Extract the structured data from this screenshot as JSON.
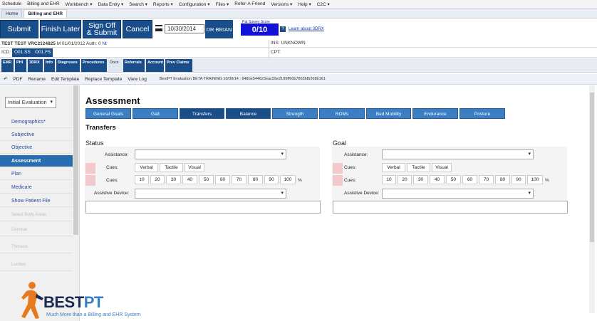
{
  "menu": [
    "Schedule",
    "Billing and EHR",
    "Workbench ▾",
    "Data Entry ▾",
    "Search ▾",
    "Reports ▾",
    "Configuration ▾",
    "Files ▾",
    "Refer-A-Friend",
    "Versions ▾",
    "Help ▾",
    "C2C ▾"
  ],
  "tabs": [
    "Home",
    "Billing and EHR"
  ],
  "actions": {
    "submit": "Submit",
    "finish_later": "Finish Later",
    "sign_off_1": "Sign Off",
    "sign_off_2": "& Submit",
    "cancel": "Cancel",
    "date": "10/30/2014",
    "provider": "DR BRIAN"
  },
  "survey": {
    "label": "Pat Survey Score",
    "score": "0/10",
    "help": "?",
    "learn": "Learn about 3DRX"
  },
  "patient": {
    "name": "TEST TEST",
    "id": "VRC2124825",
    "sex": "M",
    "dob": "01/01/2012",
    "auth_label": "Auth: 0",
    "auth_link": "Nt",
    "ins": "INS: UNKNOWN",
    "cpt": "CPT:"
  },
  "icd": {
    "label": "ICD:",
    "codes": [
      "O01.SS",
      "O01.FS"
    ]
  },
  "nav_buttons": [
    "EMR",
    "PHI",
    "3DRX",
    "Info",
    "Diagnoses",
    "Procedures",
    "Docs",
    "Referrals",
    "Account",
    "Prev Claims"
  ],
  "toolbar": {
    "back": "↶",
    "items": [
      "PDF",
      "Rename",
      "Edit Template",
      "Replace Template",
      "View Log"
    ],
    "title": "BestPT Evaluation BETA TRAINING 10/30/14 : 948be544623eac56e2199ff60b7865fd6268b161"
  },
  "sidebar": {
    "select": "Initial Evaluation",
    "items": [
      "Demographics*",
      "Subjective",
      "Objective",
      "Assessment",
      "Plan",
      "Medicare",
      "Show Patient File",
      "Select Body Areas",
      "Cervical",
      "Thoracic",
      "Lumbar"
    ]
  },
  "main": {
    "heading": "Assessment",
    "subtabs": [
      "General Goals",
      "Gait",
      "Transfers",
      "Balance",
      "Strength",
      "ROMs",
      "Bed Mobility",
      "Endurance",
      "Posture"
    ],
    "section": "Transfers",
    "status": "Status",
    "goal": "Goal",
    "assistance": "Assistance:",
    "cues": "Cues:",
    "cue_types": [
      "Verbal",
      "Tactile",
      "Visual"
    ],
    "percents": [
      "10",
      "20",
      "30",
      "40",
      "50",
      "60",
      "70",
      "80",
      "90",
      "100"
    ],
    "pct_sign": "%",
    "assistive": "Assistive Device:"
  },
  "logo": {
    "best": "BEST",
    "pt": "PT",
    "tagline": "Much More than a Billing and EHR System"
  }
}
